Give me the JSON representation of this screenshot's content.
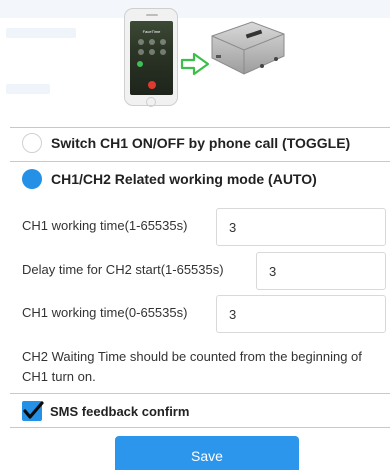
{
  "illustration": {
    "phone_call_title": "FaceTime",
    "arrow_color": "#3cbf4a"
  },
  "modes": [
    {
      "label": "Switch CH1 ON/OFF by phone call (TOGGLE)",
      "selected": false
    },
    {
      "label": "CH1/CH2 Related working mode (AUTO)",
      "selected": true
    }
  ],
  "fields": [
    {
      "label": "CH1 working time(1-65535s)",
      "value": "3"
    },
    {
      "label": "Delay time for CH2 start(1-65535s)",
      "value": "3"
    },
    {
      "label": "CH1 working time(0-65535s)",
      "value": "3"
    }
  ],
  "note": "CH2 Waiting Time should be counted from the beginning of CH1 turn on.",
  "sms_feedback": {
    "label": "SMS feedback confirm",
    "checked": true
  },
  "save_label": "Save",
  "colors": {
    "accent": "#2490e6",
    "button": "#2c95ec"
  }
}
